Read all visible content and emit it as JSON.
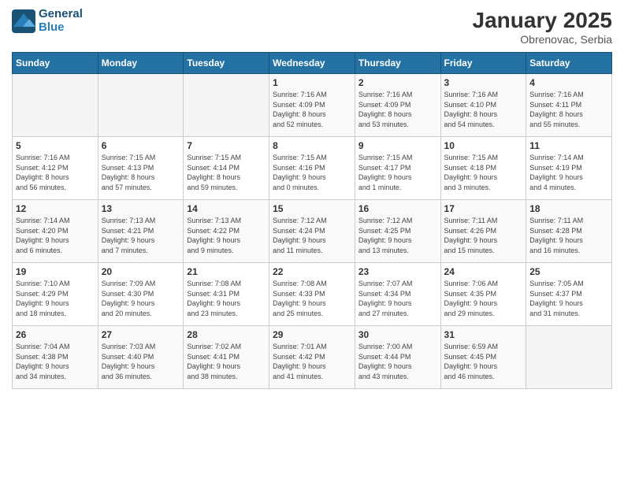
{
  "header": {
    "logo_line1": "General",
    "logo_line2": "Blue",
    "month_title": "January 2025",
    "location": "Obrenovac, Serbia"
  },
  "weekdays": [
    "Sunday",
    "Monday",
    "Tuesday",
    "Wednesday",
    "Thursday",
    "Friday",
    "Saturday"
  ],
  "weeks": [
    [
      {
        "day": "",
        "info": ""
      },
      {
        "day": "",
        "info": ""
      },
      {
        "day": "",
        "info": ""
      },
      {
        "day": "1",
        "info": "Sunrise: 7:16 AM\nSunset: 4:09 PM\nDaylight: 8 hours\nand 52 minutes."
      },
      {
        "day": "2",
        "info": "Sunrise: 7:16 AM\nSunset: 4:09 PM\nDaylight: 8 hours\nand 53 minutes."
      },
      {
        "day": "3",
        "info": "Sunrise: 7:16 AM\nSunset: 4:10 PM\nDaylight: 8 hours\nand 54 minutes."
      },
      {
        "day": "4",
        "info": "Sunrise: 7:16 AM\nSunset: 4:11 PM\nDaylight: 8 hours\nand 55 minutes."
      }
    ],
    [
      {
        "day": "5",
        "info": "Sunrise: 7:16 AM\nSunset: 4:12 PM\nDaylight: 8 hours\nand 56 minutes."
      },
      {
        "day": "6",
        "info": "Sunrise: 7:15 AM\nSunset: 4:13 PM\nDaylight: 8 hours\nand 57 minutes."
      },
      {
        "day": "7",
        "info": "Sunrise: 7:15 AM\nSunset: 4:14 PM\nDaylight: 8 hours\nand 59 minutes."
      },
      {
        "day": "8",
        "info": "Sunrise: 7:15 AM\nSunset: 4:16 PM\nDaylight: 9 hours\nand 0 minutes."
      },
      {
        "day": "9",
        "info": "Sunrise: 7:15 AM\nSunset: 4:17 PM\nDaylight: 9 hours\nand 1 minute."
      },
      {
        "day": "10",
        "info": "Sunrise: 7:15 AM\nSunset: 4:18 PM\nDaylight: 9 hours\nand 3 minutes."
      },
      {
        "day": "11",
        "info": "Sunrise: 7:14 AM\nSunset: 4:19 PM\nDaylight: 9 hours\nand 4 minutes."
      }
    ],
    [
      {
        "day": "12",
        "info": "Sunrise: 7:14 AM\nSunset: 4:20 PM\nDaylight: 9 hours\nand 6 minutes."
      },
      {
        "day": "13",
        "info": "Sunrise: 7:13 AM\nSunset: 4:21 PM\nDaylight: 9 hours\nand 7 minutes."
      },
      {
        "day": "14",
        "info": "Sunrise: 7:13 AM\nSunset: 4:22 PM\nDaylight: 9 hours\nand 9 minutes."
      },
      {
        "day": "15",
        "info": "Sunrise: 7:12 AM\nSunset: 4:24 PM\nDaylight: 9 hours\nand 11 minutes."
      },
      {
        "day": "16",
        "info": "Sunrise: 7:12 AM\nSunset: 4:25 PM\nDaylight: 9 hours\nand 13 minutes."
      },
      {
        "day": "17",
        "info": "Sunrise: 7:11 AM\nSunset: 4:26 PM\nDaylight: 9 hours\nand 15 minutes."
      },
      {
        "day": "18",
        "info": "Sunrise: 7:11 AM\nSunset: 4:28 PM\nDaylight: 9 hours\nand 16 minutes."
      }
    ],
    [
      {
        "day": "19",
        "info": "Sunrise: 7:10 AM\nSunset: 4:29 PM\nDaylight: 9 hours\nand 18 minutes."
      },
      {
        "day": "20",
        "info": "Sunrise: 7:09 AM\nSunset: 4:30 PM\nDaylight: 9 hours\nand 20 minutes."
      },
      {
        "day": "21",
        "info": "Sunrise: 7:08 AM\nSunset: 4:31 PM\nDaylight: 9 hours\nand 23 minutes."
      },
      {
        "day": "22",
        "info": "Sunrise: 7:08 AM\nSunset: 4:33 PM\nDaylight: 9 hours\nand 25 minutes."
      },
      {
        "day": "23",
        "info": "Sunrise: 7:07 AM\nSunset: 4:34 PM\nDaylight: 9 hours\nand 27 minutes."
      },
      {
        "day": "24",
        "info": "Sunrise: 7:06 AM\nSunset: 4:35 PM\nDaylight: 9 hours\nand 29 minutes."
      },
      {
        "day": "25",
        "info": "Sunrise: 7:05 AM\nSunset: 4:37 PM\nDaylight: 9 hours\nand 31 minutes."
      }
    ],
    [
      {
        "day": "26",
        "info": "Sunrise: 7:04 AM\nSunset: 4:38 PM\nDaylight: 9 hours\nand 34 minutes."
      },
      {
        "day": "27",
        "info": "Sunrise: 7:03 AM\nSunset: 4:40 PM\nDaylight: 9 hours\nand 36 minutes."
      },
      {
        "day": "28",
        "info": "Sunrise: 7:02 AM\nSunset: 4:41 PM\nDaylight: 9 hours\nand 38 minutes."
      },
      {
        "day": "29",
        "info": "Sunrise: 7:01 AM\nSunset: 4:42 PM\nDaylight: 9 hours\nand 41 minutes."
      },
      {
        "day": "30",
        "info": "Sunrise: 7:00 AM\nSunset: 4:44 PM\nDaylight: 9 hours\nand 43 minutes."
      },
      {
        "day": "31",
        "info": "Sunrise: 6:59 AM\nSunset: 4:45 PM\nDaylight: 9 hours\nand 46 minutes."
      },
      {
        "day": "",
        "info": ""
      }
    ]
  ]
}
